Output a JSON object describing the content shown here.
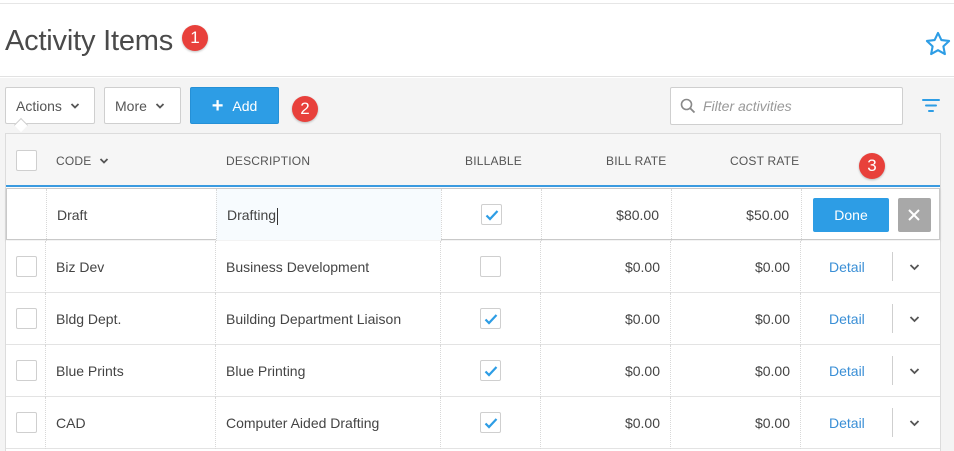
{
  "header": {
    "title": "Activity Items",
    "badges": [
      "1",
      "2",
      "3"
    ]
  },
  "toolbar": {
    "actions_label": "Actions",
    "more_label": "More",
    "add_label": "Add",
    "filter_placeholder": "Filter activities"
  },
  "table": {
    "columns": {
      "code": "CODE",
      "description": "DESCRIPTION",
      "billable": "BILLABLE",
      "bill_rate": "BILL RATE",
      "cost_rate": "COST RATE"
    },
    "editing_row": {
      "code": "Draft",
      "description": "Drafting",
      "billable": true,
      "bill_rate": "$80.00",
      "cost_rate": "$50.00",
      "done_label": "Done"
    },
    "rows": [
      {
        "code": "Biz Dev",
        "description": "Business Development",
        "billable": false,
        "bill_rate": "$0.00",
        "cost_rate": "$0.00",
        "action": "Detail"
      },
      {
        "code": "Bldg Dept.",
        "description": "Building Department Liaison",
        "billable": true,
        "bill_rate": "$0.00",
        "cost_rate": "$0.00",
        "action": "Detail"
      },
      {
        "code": "Blue Prints",
        "description": "Blue Printing",
        "billable": true,
        "bill_rate": "$0.00",
        "cost_rate": "$0.00",
        "action": "Detail"
      },
      {
        "code": "CAD",
        "description": "Computer Aided Drafting",
        "billable": true,
        "bill_rate": "$0.00",
        "cost_rate": "$0.00",
        "action": "Detail"
      }
    ]
  },
  "colors": {
    "accent": "#2d9de5",
    "badge": "#e8403b",
    "link": "#3a8fd6"
  },
  "icons": {
    "favorite": "star-icon",
    "search": "search-icon",
    "filter": "funnel-icon",
    "close": "close-icon",
    "expand": "chevron-down-icon",
    "check": "check-icon",
    "add": "plus-icon"
  }
}
